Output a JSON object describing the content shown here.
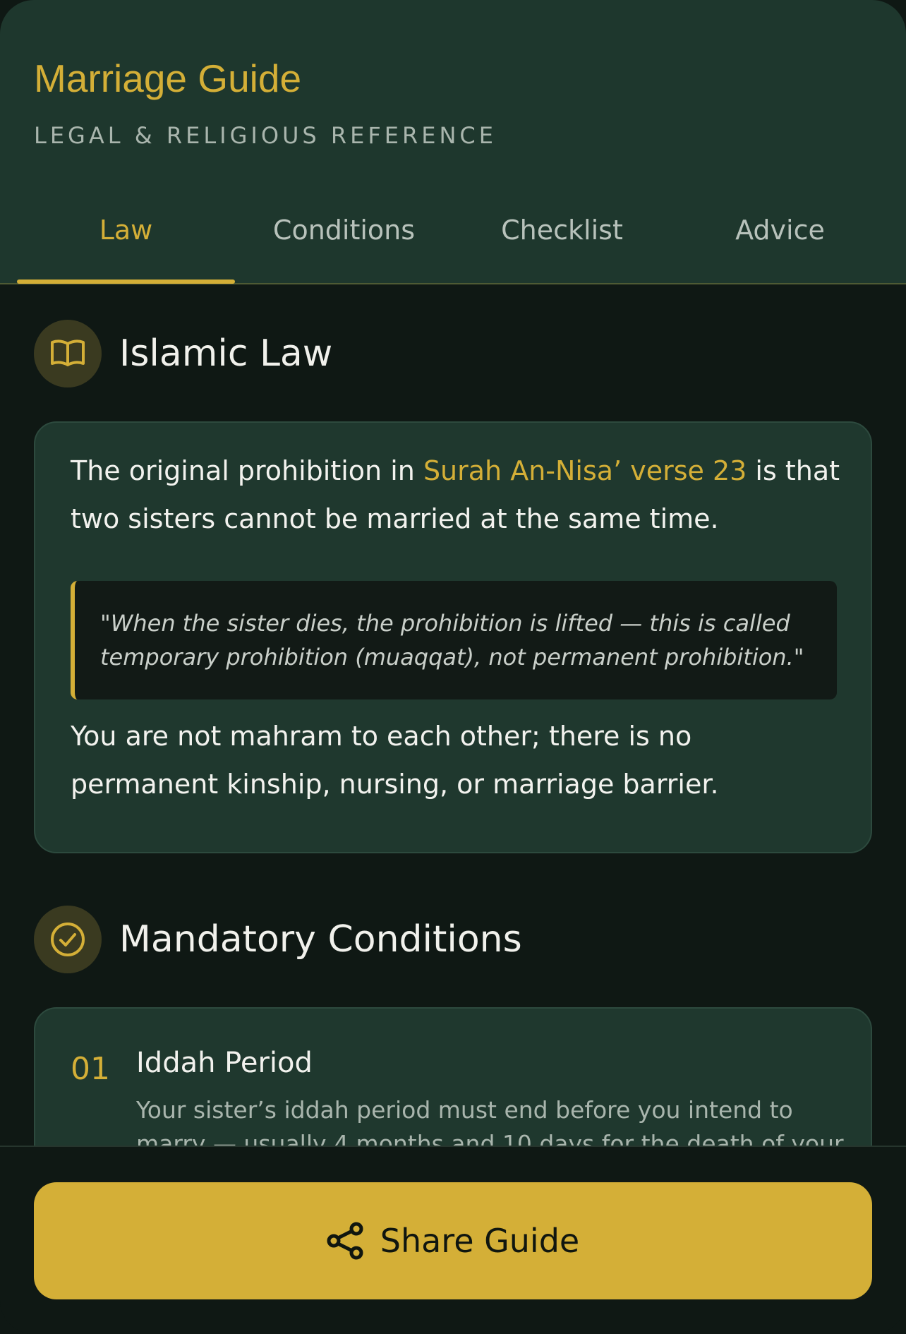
{
  "header": {
    "title": "Marriage Guide",
    "subtitle": "LEGAL & RELIGIOUS REFERENCE"
  },
  "tabs": [
    {
      "label": "Law",
      "active": true
    },
    {
      "label": "Conditions",
      "active": false
    },
    {
      "label": "Checklist",
      "active": false
    },
    {
      "label": "Advice",
      "active": false
    }
  ],
  "law_section": {
    "title": "Islamic Law",
    "icon": "book-icon",
    "para1_before": "The original prohibition in ",
    "para1_highlight": "Surah An-Nisa’ verse 23",
    "para1_after": " is that two sisters cannot be married at the same time.",
    "quote": "\"When the sister dies, the prohibition is lifted — this is called temporary prohibition (muaqqat), not permanent prohibition.\"",
    "para2": "You are not mahram to each other; there is no permanent kinship, nursing, or marriage barrier."
  },
  "conditions_section": {
    "title": "Mandatory Conditions",
    "icon": "check-circle-icon",
    "items": [
      {
        "number": "01",
        "title": "Iddah Period",
        "description": "Your sister’s iddah period must end before you intend to marry — usually 4 months and 10 days for the death of your"
      }
    ]
  },
  "footer": {
    "share_label": "Share Guide",
    "icon": "share-icon"
  },
  "colors": {
    "accent": "#d4af37",
    "header_bg": "#1e372d",
    "page_bg": "#0f1814",
    "card_bg": "#1f382e"
  }
}
